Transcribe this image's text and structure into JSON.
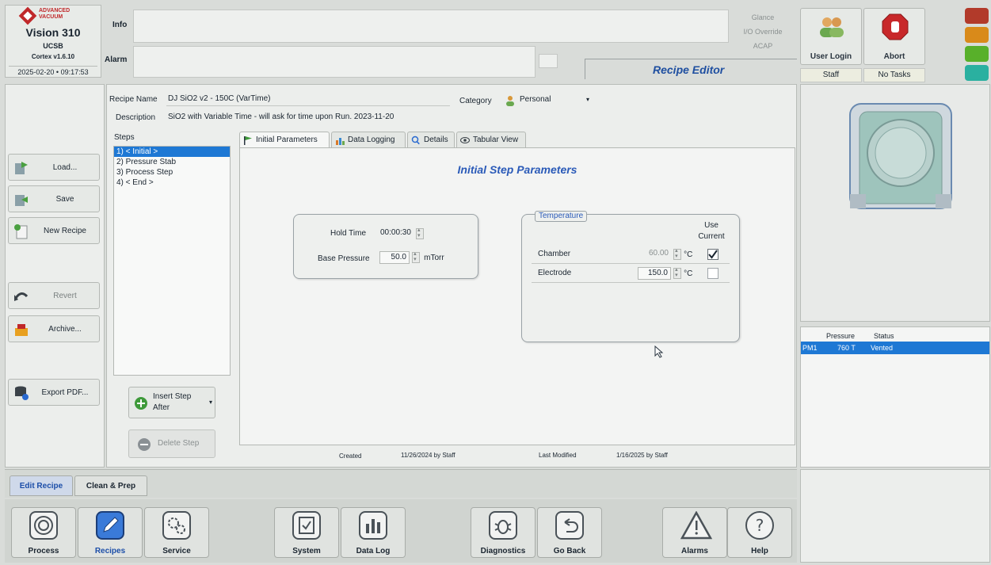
{
  "brand": {
    "company": "ADVANCED VACUUM",
    "system": "Vision 310",
    "site": "UCSB",
    "version": "Cortex v1.6.10",
    "datetime": "2025-02-20 • 09:17:53"
  },
  "header": {
    "info_label": "Info",
    "alarm_label": "Alarm",
    "modes": [
      "Glance",
      "I/O Override",
      "ACAP"
    ],
    "screen_title": "Recipe Editor",
    "user_login_label": "User Login",
    "abort_label": "Abort",
    "user_state": "Staff",
    "task_state": "No Tasks",
    "lamp_colors": [
      "#b23a2a",
      "#d98a1a",
      "#58b02a",
      "#2ab0a0"
    ]
  },
  "left_buttons": {
    "load": "Load...",
    "save": "Save",
    "new_recipe": "New Recipe",
    "revert": "Revert",
    "archive": "Archive...",
    "export_pdf": "Export PDF..."
  },
  "recipe": {
    "name_label": "Recipe Name",
    "name_value": "DJ SiO2 v2 - 150C (VarTime)",
    "description_label": "Description",
    "description_value": "SiO2 with Variable Time - will ask for time upon Run. 2023-11-20",
    "category_label": "Category",
    "category_value": "Personal"
  },
  "steps": {
    "label": "Steps",
    "items": [
      "1) < Initial >",
      "2) Pressure Stab",
      "3) Process Step",
      "4) < End >"
    ],
    "insert_label_1": "Insert Step",
    "insert_label_2": "After",
    "delete_label": "Delete Step"
  },
  "tabs": [
    "Initial Parameters",
    "Data Logging",
    "Details",
    "Tabular View"
  ],
  "initial": {
    "heading": "Initial Step Parameters",
    "hold_time_label": "Hold Time",
    "hold_time_value": "00:00:30",
    "base_pressure_label": "Base Pressure",
    "base_pressure_value": "50.0",
    "base_pressure_unit": "mTorr"
  },
  "temperature": {
    "title": "Temperature",
    "use_current_1": "Use",
    "use_current_2": "Current",
    "rows": [
      {
        "label": "Chamber",
        "value": "60.00",
        "unit": "°C",
        "use_current": true
      },
      {
        "label": "Electrode",
        "value": "150.0",
        "unit": "°C",
        "use_current": false
      }
    ]
  },
  "footer_info": {
    "created_label": "Created",
    "created_value": "11/26/2024 by Staff",
    "modified_label": "Last Modified",
    "modified_value": "1/16/2025 by Staff"
  },
  "pm_table": {
    "headers": [
      "",
      "Pressure",
      "Status"
    ],
    "rows": [
      [
        "PM1",
        "760 T",
        "Vented"
      ]
    ]
  },
  "context_tabs": [
    "Edit Recipe",
    "Clean & Prep"
  ],
  "nav": [
    "Process",
    "Recipes",
    "Service",
    "System",
    "Data Log",
    "Diagnostics",
    "Go Back",
    "Alarms",
    "Help"
  ]
}
